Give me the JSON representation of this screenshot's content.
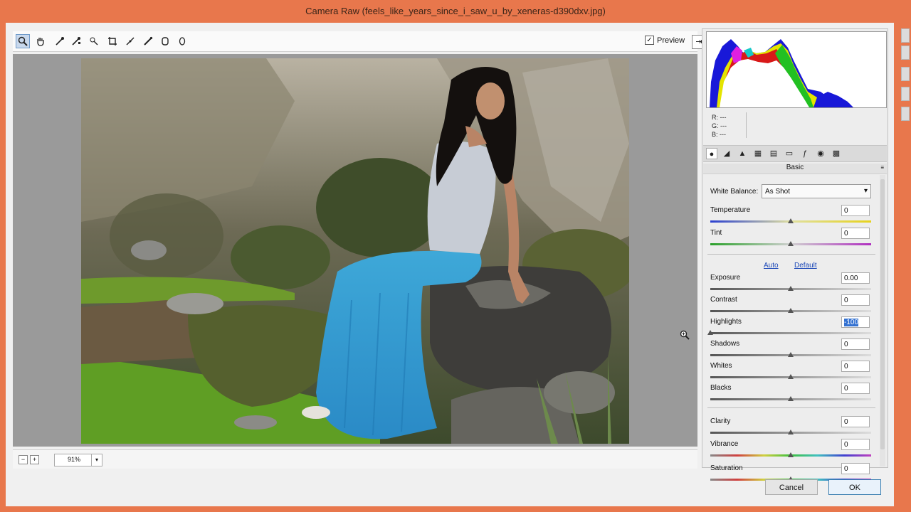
{
  "window": {
    "title": "Camera Raw (feels_like_years_since_i_saw_u_by_xeneras-d390dxv.jpg)"
  },
  "toolbar": {
    "tools": [
      {
        "name": "zoom-tool-icon",
        "glyph": "🔍︎"
      },
      {
        "name": "hand-tool-icon",
        "glyph": "✋︎"
      },
      {
        "name": "white-balance-tool-icon",
        "glyph": "⟋"
      },
      {
        "name": "color-sampler-tool-icon",
        "glyph": "⟋"
      },
      {
        "name": "targeted-adjustment-tool-icon",
        "glyph": "◎"
      },
      {
        "name": "crop-tool-icon",
        "glyph": "⌗"
      },
      {
        "name": "straighten-tool-icon",
        "glyph": "⟋"
      },
      {
        "name": "spot-removal-tool-icon",
        "glyph": "✎"
      },
      {
        "name": "red-eye-tool-icon",
        "glyph": "⊙"
      },
      {
        "name": "adjustment-brush-icon",
        "glyph": "⬮"
      }
    ],
    "preview_label": "Preview",
    "preview_checked": "✓"
  },
  "status": {
    "zoom_value": "91%"
  },
  "histogram": {
    "r_label": "R:",
    "g_label": "G:",
    "b_label": "B:",
    "r_value": "---",
    "g_value": "---",
    "b_value": "---"
  },
  "panel": {
    "section_title": "Basic",
    "white_balance_label": "White Balance:",
    "white_balance_value": "As Shot",
    "auto_label": "Auto",
    "default_label": "Default",
    "sliders": [
      {
        "label": "Temperature",
        "value": "0",
        "level": 0.5
      },
      {
        "label": "Tint",
        "value": "0",
        "level": 0.5
      },
      {
        "label": "Exposure",
        "value": "0.00",
        "level": 0.5
      },
      {
        "label": "Contrast",
        "value": "0",
        "level": 0.5
      },
      {
        "label": "Highlights",
        "value": "-100",
        "level": 0.0
      },
      {
        "label": "Shadows",
        "value": "0",
        "level": 0.5
      },
      {
        "label": "Whites",
        "value": "0",
        "level": 0.5
      },
      {
        "label": "Blacks",
        "value": "0",
        "level": 0.5
      },
      {
        "label": "Clarity",
        "value": "0",
        "level": 0.5
      },
      {
        "label": "Vibrance",
        "value": "0",
        "level": 0.5
      },
      {
        "label": "Saturation",
        "value": "0",
        "level": 0.5
      }
    ]
  },
  "buttons": {
    "cancel": "Cancel",
    "ok": "OK"
  },
  "colors": {
    "titlebar": "#e8774c",
    "accent": "#3371d1"
  }
}
